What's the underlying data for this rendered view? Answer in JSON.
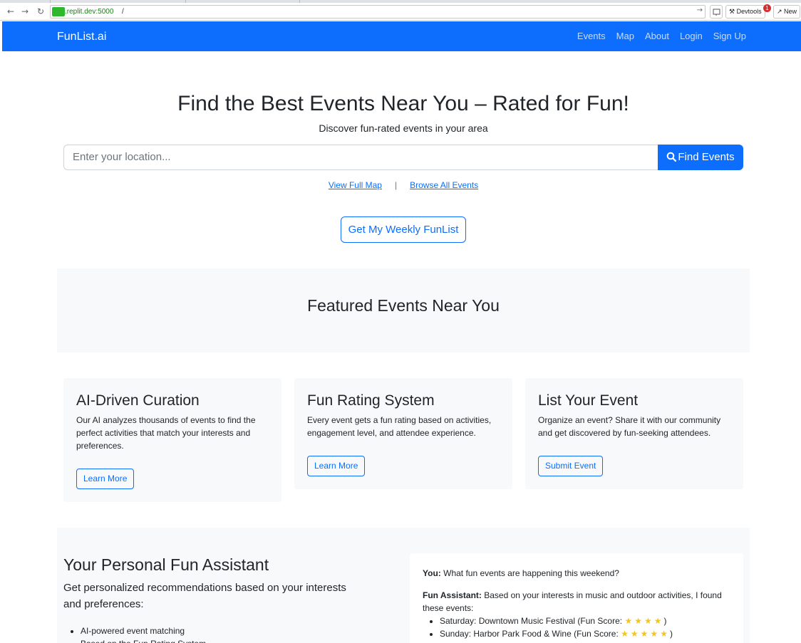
{
  "browser": {
    "url_host": ".replit.dev:5000",
    "url_path": "/",
    "devtools_label": "Devtools",
    "devtools_badge": "1",
    "new_label": "New"
  },
  "navbar": {
    "brand": "FunList.ai",
    "links": [
      "Events",
      "Map",
      "About",
      "Login",
      "Sign Up"
    ]
  },
  "hero": {
    "title": "Find the Best Events Near You – Rated for Fun!",
    "subtitle": "Discover fun-rated events in your area",
    "search_placeholder": "Enter your location...",
    "search_button": "Find Events",
    "link_map": "View Full Map",
    "link_separator": "|",
    "link_browse": "Browse All Events",
    "weekly_button": "Get My Weekly FunList"
  },
  "featured": {
    "title": "Featured Events Near You"
  },
  "cards": [
    {
      "title": "AI-Driven Curation",
      "text": "Our AI analyzes thousands of events to find the perfect activities that match your interests and preferences.",
      "button": "Learn More"
    },
    {
      "title": "Fun Rating System",
      "text": "Every event gets a fun rating based on activities, engagement level, and attendee experience.",
      "button": "Learn More"
    },
    {
      "title": "List Your Event",
      "text": "Organize an event? Share it with our community and get discovered by fun-seeking attendees.",
      "button": "Submit Event"
    }
  ],
  "assistant": {
    "title": "Your Personal Fun Assistant",
    "lead": "Get personalized recommendations based on your interests and preferences:",
    "bullets": [
      "AI-powered event matching",
      "Based on the Fun Rating System"
    ],
    "chat": {
      "you_label": "You:",
      "you_text": "What fun events are happening this weekend?",
      "bot_label": "Fun Assistant:",
      "bot_text": "Based on your interests in music and outdoor activities, I found these events:",
      "events": [
        {
          "text": "Saturday: Downtown Music Festival (Fun Score:",
          "stars": 4
        },
        {
          "text": "Sunday: Harbor Park Food & Wine (Fun Score:",
          "stars": 5
        }
      ]
    }
  },
  "colors": {
    "primary": "#0d6efd",
    "section_bg": "#f8f9fa",
    "star": "#f5c518"
  }
}
